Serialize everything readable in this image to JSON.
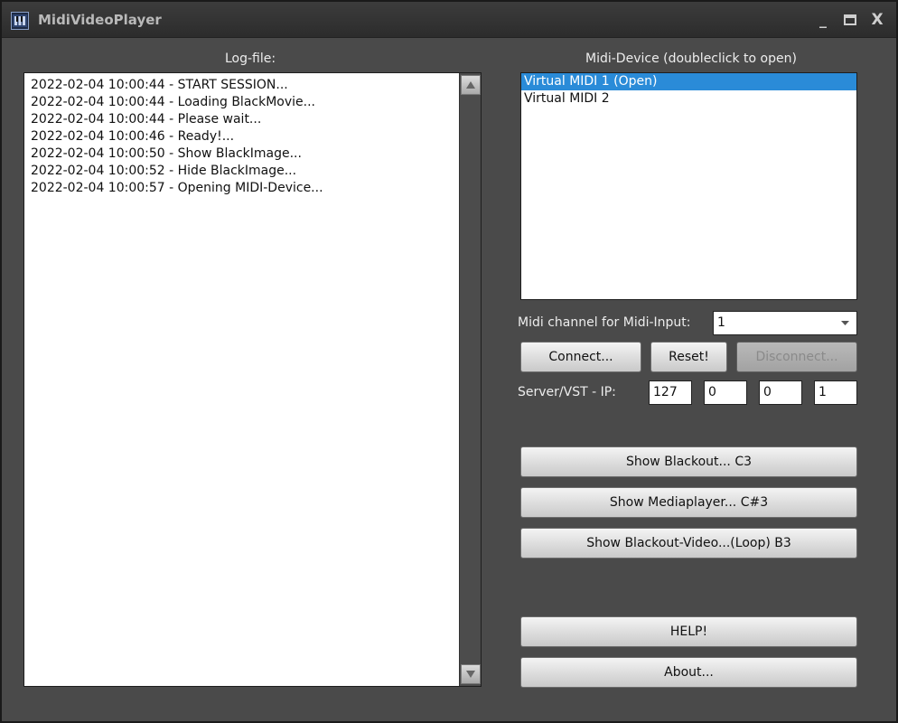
{
  "window": {
    "title": "MidiVideoPlayer",
    "controls": {
      "minimize": "_",
      "maximize": "▭",
      "close": "X"
    }
  },
  "log": {
    "label": "Log-file:",
    "lines": [
      "2022-02-04 10:00:44 - START SESSION...",
      "2022-02-04 10:00:44 - Loading BlackMovie...",
      "2022-02-04 10:00:44 - Please wait...",
      "2022-02-04 10:00:46 - Ready!...",
      "2022-02-04 10:00:50 - Show BlackImage...",
      "2022-02-04 10:00:52 - Hide BlackImage...",
      "2022-02-04 10:00:57 - Opening MIDI-Device..."
    ]
  },
  "midi": {
    "label": "Midi-Device (doubleclick to open)",
    "devices": [
      "Virtual MIDI 1 (Open)",
      "Virtual MIDI 2"
    ],
    "selected_index": 0,
    "channel_label": "Midi channel for Midi-Input:",
    "channel_value": "1"
  },
  "buttons": {
    "connect": "Connect...",
    "reset": "Reset!",
    "disconnect": "Disconnect...",
    "show_blackout": "Show Blackout... C3",
    "show_mediaplayer": "Show Mediaplayer... C#3",
    "show_blackout_video": "Show Blackout-Video...(Loop) B3",
    "help": "HELP!",
    "about": "About..."
  },
  "server": {
    "label": "Server/VST - IP:",
    "ip": [
      "127",
      "0",
      "0",
      "1"
    ]
  },
  "colors": {
    "background": "#4a4a4a",
    "selection": "#2a8bd8"
  }
}
